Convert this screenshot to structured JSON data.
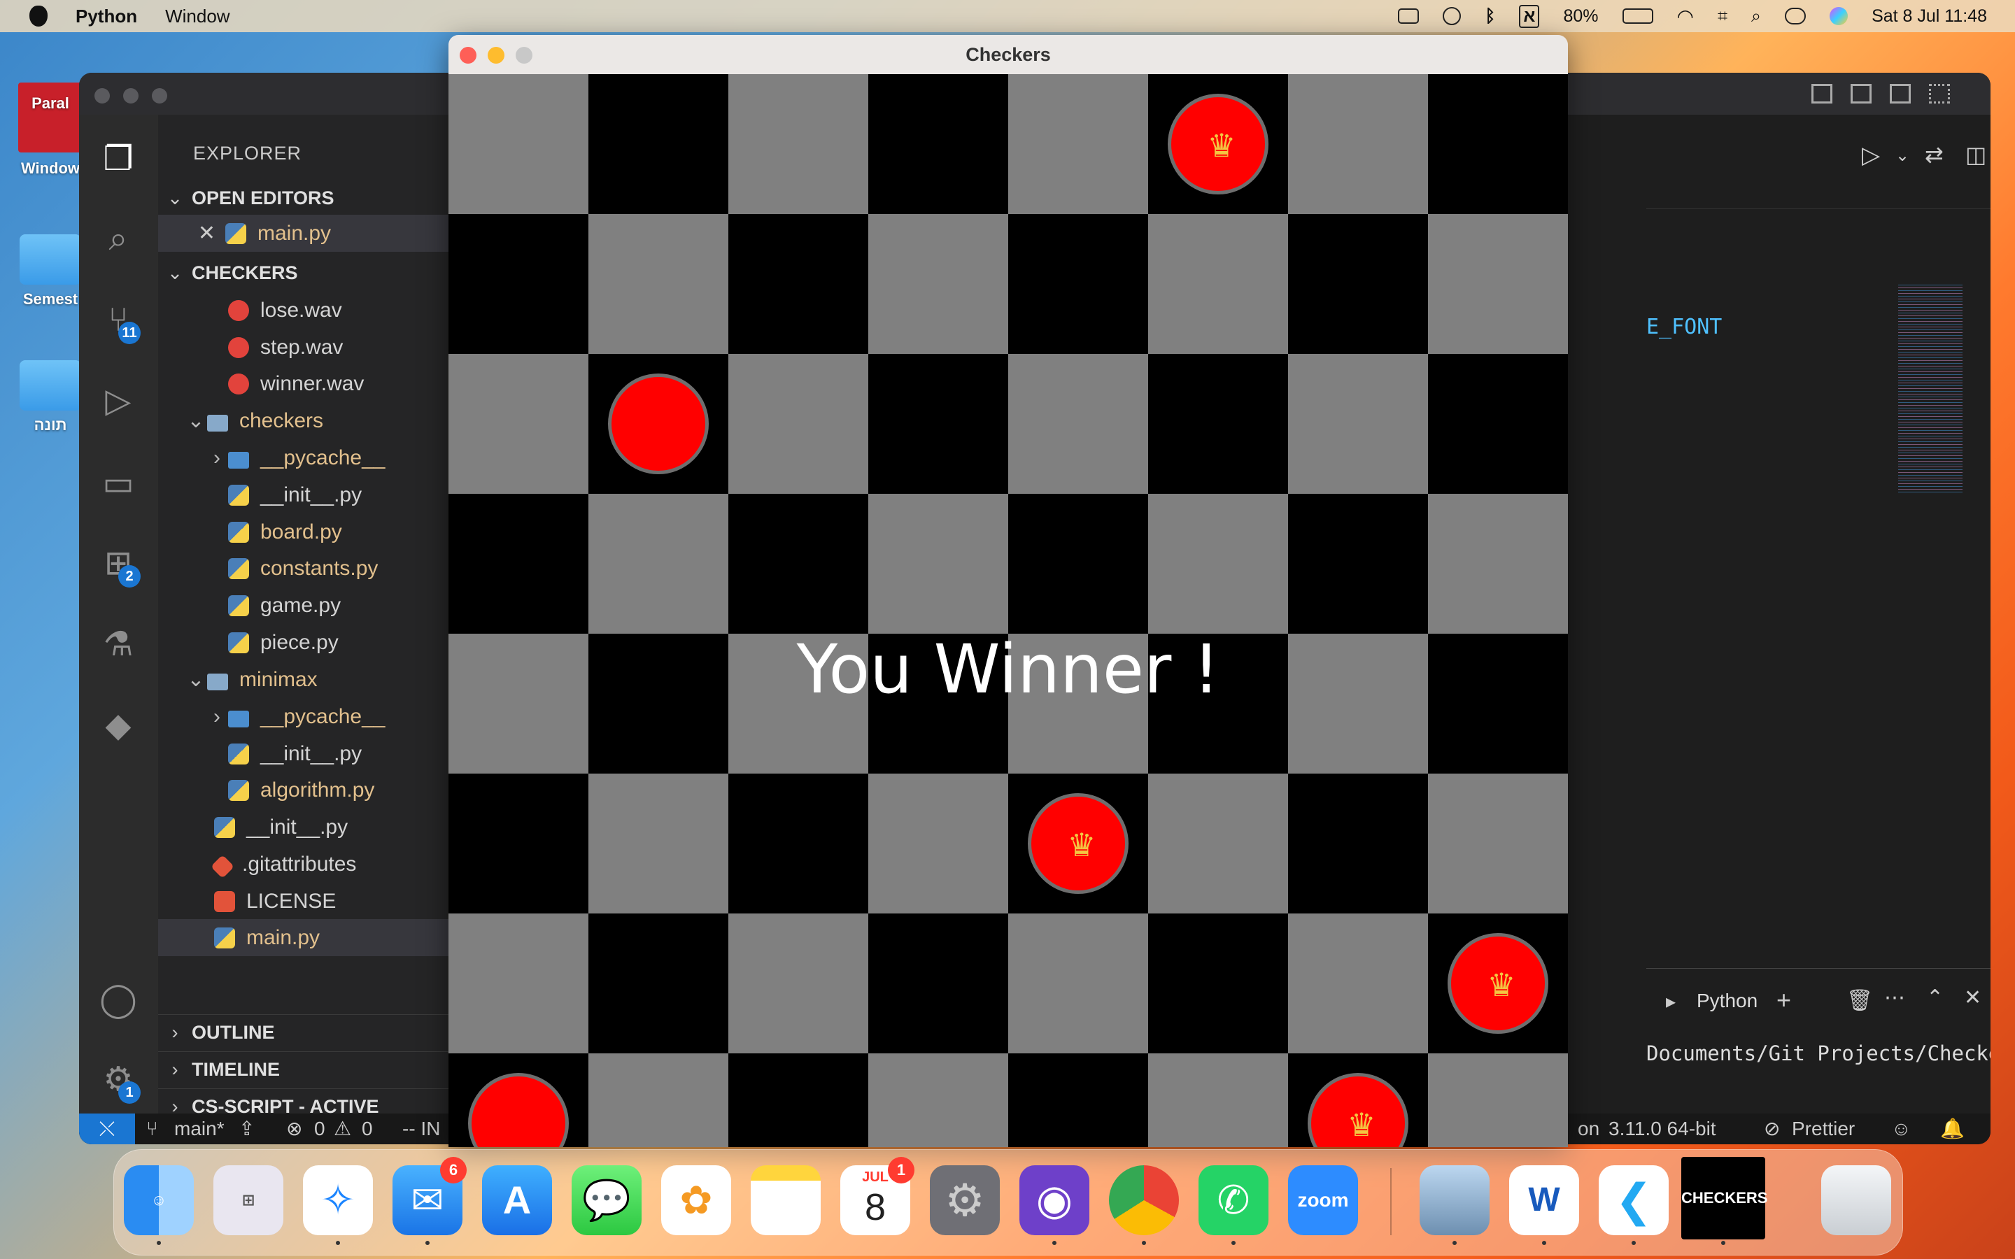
{
  "menubar": {
    "app": "Python",
    "menu_window": "Window",
    "battery": "80%",
    "datetime": "Sat 8 Jul  11:48",
    "input_lang": "א"
  },
  "desktop": {
    "icon1": "Window",
    "icon2": "Semest",
    "icon3": "תונה",
    "parallels_label": "Paral"
  },
  "vscode": {
    "explorer_title": "EXPLORER",
    "open_editors": "OPEN EDITORS",
    "open_file": "main.py",
    "project": "CHECKERS",
    "files": [
      {
        "name": "lose.wav"
      },
      {
        "name": "step.wav"
      },
      {
        "name": "winner.wav"
      },
      {
        "name": "checkers"
      },
      {
        "name": "__pycache__"
      },
      {
        "name": "__init__.py"
      },
      {
        "name": "board.py"
      },
      {
        "name": "constants.py"
      },
      {
        "name": "game.py"
      },
      {
        "name": "piece.py"
      },
      {
        "name": "minimax"
      },
      {
        "name": "__pycache__"
      },
      {
        "name": "__init__.py"
      },
      {
        "name": "algorithm.py"
      },
      {
        "name": "__init__.py"
      },
      {
        "name": ".gitattributes"
      },
      {
        "name": "LICENSE"
      },
      {
        "name": "main.py"
      }
    ],
    "outline": "OUTLINE",
    "timeline": "TIMELINE",
    "cs_script": "CS-SCRIPT - ACTIVE",
    "badges": {
      "source_control": "11",
      "extensions": "2",
      "settings": "1"
    },
    "code_fragment": "E_FONT",
    "terminal": {
      "profile": "Python",
      "path": "Documents/Git Projects/Checkers/"
    },
    "status": {
      "branch": "main*",
      "errors": "0",
      "warnings": "0",
      "mode": "-- IN",
      "lang_tail": "on",
      "interpreter": "3.11.0 64-bit",
      "prettier": "Prettier"
    }
  },
  "checkers": {
    "title": "Checkers",
    "message": "You Winner !",
    "crown_glyph": "♛"
  },
  "dock": {
    "mail_badge": "6",
    "calendar_badge": "1",
    "calendar_month": "JUL",
    "calendar_day": "8",
    "zoom_label": "zoom",
    "checkers_label": "CHECKERS",
    "word_label": "W"
  }
}
